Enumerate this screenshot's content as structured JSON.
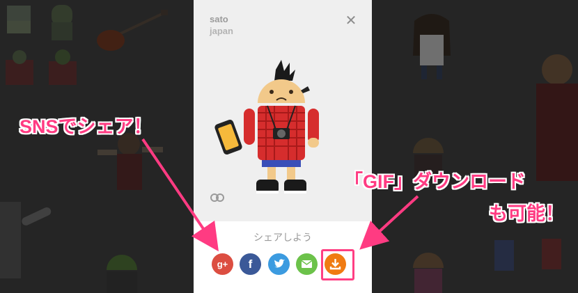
{
  "modal": {
    "user_name": "sato",
    "user_country": "japan",
    "close_symbol": "✕",
    "share_label": "シェアしよう",
    "share_buttons": [
      {
        "label": "g+",
        "icon": "google-plus-icon",
        "color": "#dc4e41"
      },
      {
        "label": "f",
        "icon": "facebook-icon",
        "color": "#3b5998"
      },
      {
        "label": "",
        "icon": "twitter-icon",
        "color": "#3c9be0"
      },
      {
        "label": "",
        "icon": "mail-icon",
        "color": "#6cc24a"
      },
      {
        "label": "",
        "icon": "download-icon",
        "color": "#f07b12"
      }
    ]
  },
  "annotations": {
    "sns": "SNSでシェア！",
    "gif_line1": "「GIF」ダウンロード",
    "gif_line2": "も可能！"
  },
  "colors": {
    "annotation": "#ff3b82",
    "shirt": "#d62d2d",
    "android_skin": "#f2c98a"
  }
}
